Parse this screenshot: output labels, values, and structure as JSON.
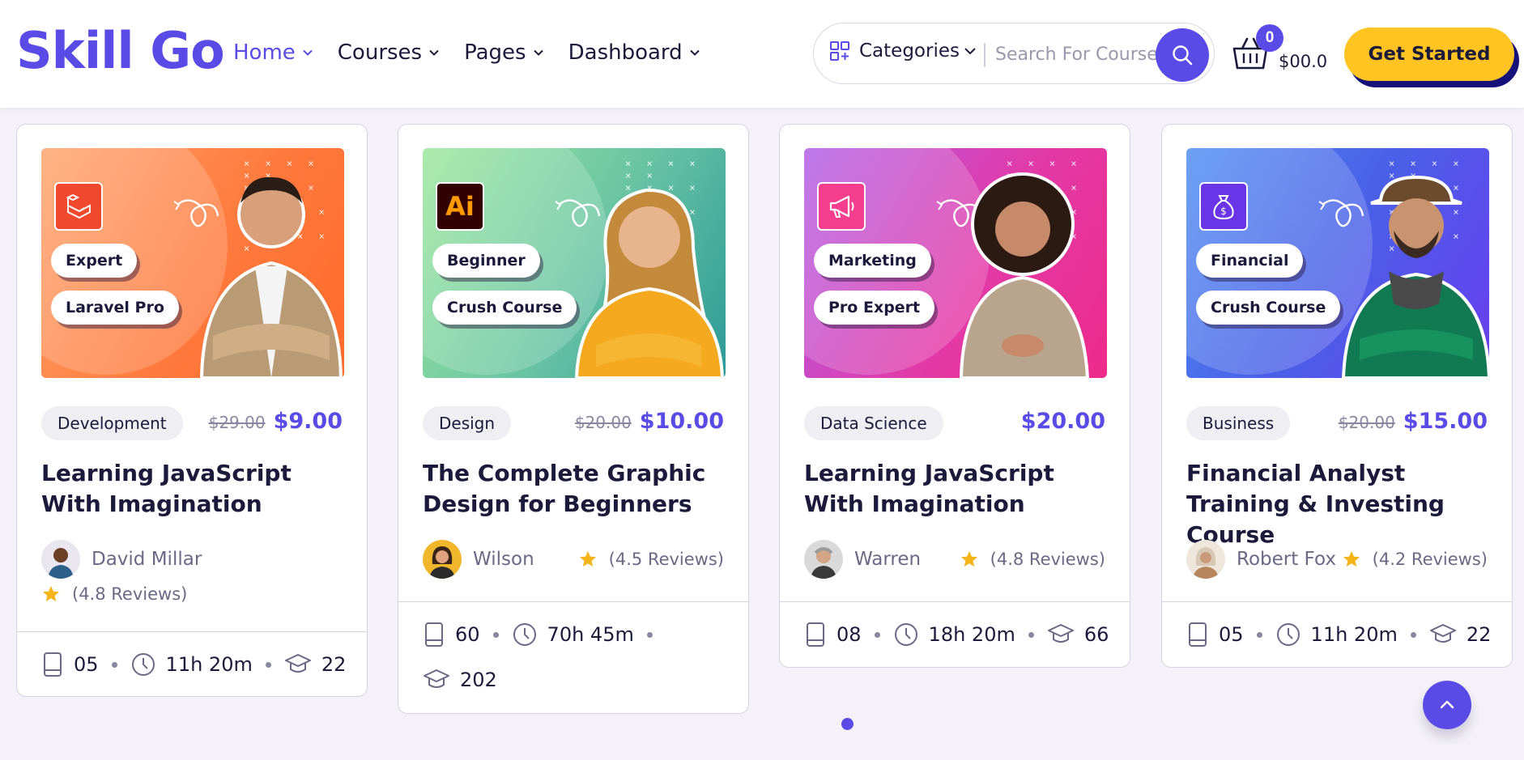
{
  "header": {
    "logo": "Skill Go",
    "nav": [
      {
        "label": "Home",
        "active": true
      },
      {
        "label": "Courses"
      },
      {
        "label": "Pages"
      },
      {
        "label": "Dashboard"
      }
    ],
    "categories_label": "Categories",
    "search_placeholder": "Search For Course",
    "cart_count": "0",
    "cart_total": "$00.0",
    "cta_label": "Get Started"
  },
  "colors": {
    "brand": "#5a4be6",
    "cta": "#ffc421",
    "star": "#f5b417"
  },
  "cards": [
    {
      "thumb_theme": "orange",
      "icon": "laravel-icon",
      "tags": [
        "Expert",
        "Laravel Pro"
      ],
      "category": "Development",
      "old_price": "$29.00",
      "price": "$9.00",
      "title": "Learning JavaScript With Imagination",
      "author": "David Millar",
      "reviews": "(4.8 Reviews)",
      "lessons": "05",
      "duration": "11h 20m",
      "students": "22"
    },
    {
      "thumb_theme": "green",
      "icon": "illustrator-icon",
      "icon_text": "Ai",
      "tags": [
        "Beginner",
        "Crush Course"
      ],
      "category": "Design",
      "old_price": "$20.00",
      "price": "$10.00",
      "title": "The Complete Graphic Design for Beginners",
      "author": "Wilson",
      "reviews": "(4.5 Reviews)",
      "lessons": "60",
      "duration": "70h 45m",
      "students": "202"
    },
    {
      "thumb_theme": "pink",
      "icon": "megaphone-icon",
      "tags": [
        "Marketing",
        "Pro Expert"
      ],
      "category": "Data Science",
      "old_price": "",
      "price": "$20.00",
      "title": "Learning JavaScript With Imagination",
      "author": "Warren",
      "reviews": "(4.8 Reviews)",
      "lessons": "08",
      "duration": "18h 20m",
      "students": "66"
    },
    {
      "thumb_theme": "blue",
      "icon": "money-bag-icon",
      "tags": [
        "Financial",
        "Crush Course"
      ],
      "category": "Business",
      "old_price": "$20.00",
      "price": "$15.00",
      "title": "Financial Analyst Training & Investing Course",
      "author": "Robert Fox",
      "reviews": "(4.2 Reviews)",
      "lessons": "05",
      "duration": "11h 20m",
      "students": "22"
    }
  ]
}
